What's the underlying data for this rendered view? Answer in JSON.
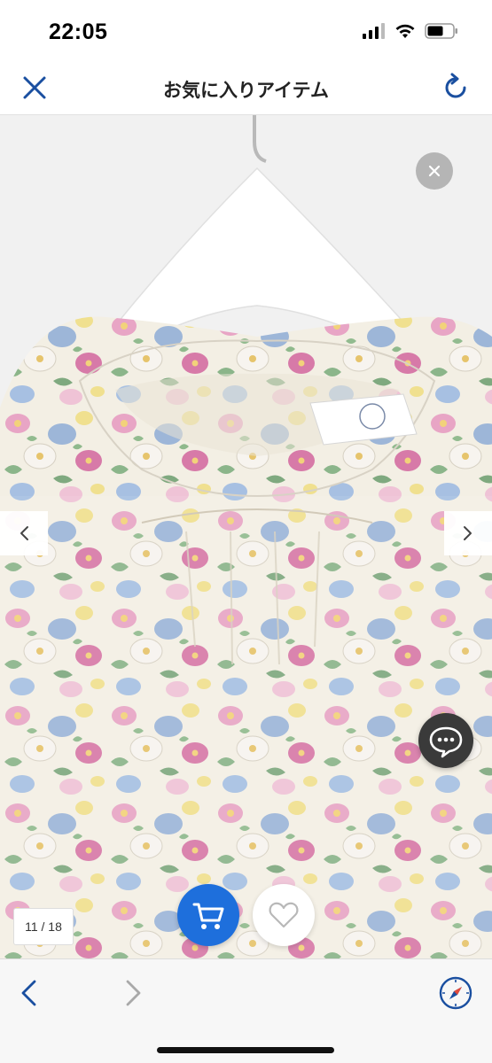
{
  "status_bar": {
    "time": "22:05",
    "signal_icon": "cellular-signal-icon",
    "wifi_icon": "wifi-icon",
    "battery_icon": "battery-icon"
  },
  "nav": {
    "title": "お気に入りアイテム",
    "close_icon": "close-x-icon",
    "reload_icon": "reload-icon"
  },
  "product_image": {
    "description_icon": "floral-blouse-photo",
    "close_icon": "close-icon",
    "prev_icon": "chevron-left-icon",
    "next_icon": "chevron-right-icon",
    "chat_icon": "chat-bubble-icon",
    "counter": "11 / 18"
  },
  "actions": {
    "cart_icon": "cart-icon",
    "favorite_icon": "heart-icon"
  },
  "toolbar": {
    "back_icon": "back-chevron-icon",
    "forward_icon": "forward-chevron-icon",
    "safari_icon": "compass-icon"
  },
  "colors": {
    "accent_blue": "#1e6fdc",
    "nav_icon_blue": "#1a4fa0"
  }
}
